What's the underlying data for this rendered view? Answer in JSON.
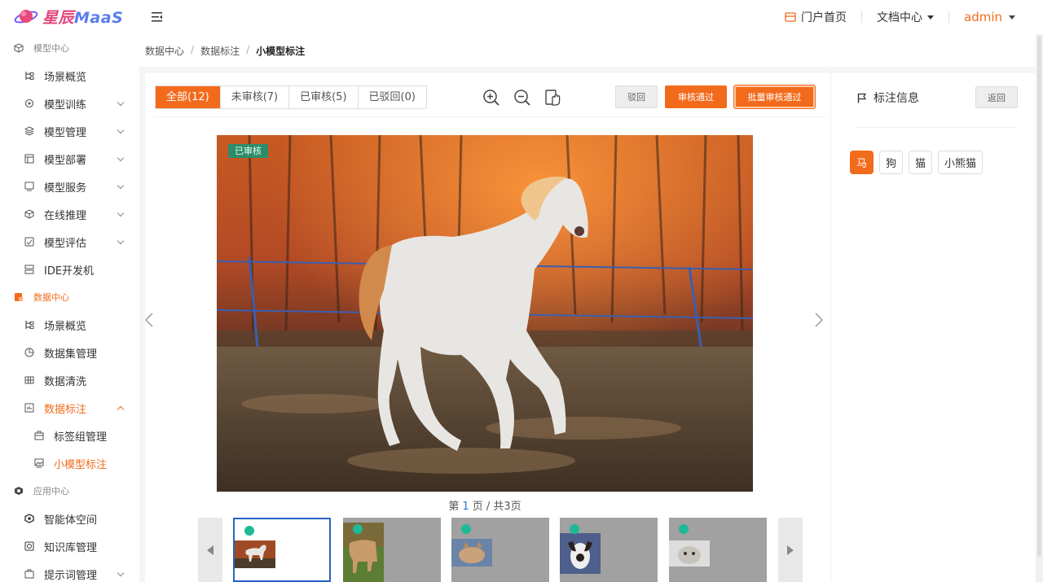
{
  "header": {
    "brand_cn": "星辰",
    "brand_en": "MaaS",
    "portal_link": "门户首页",
    "docs_link": "文档中心",
    "user": "admin"
  },
  "sidebar": {
    "groups": [
      {
        "label": "模型中心"
      },
      {
        "label": "数据中心"
      },
      {
        "label": "应用中心"
      }
    ],
    "model_items": [
      "场景概览",
      "模型训练",
      "模型管理",
      "模型部署",
      "模型服务",
      "在线推理",
      "模型评估",
      "IDE开发机"
    ],
    "data_items": [
      "场景概览",
      "数据集管理",
      "数据清洗",
      "数据标注"
    ],
    "annotation_sub": [
      "标签组管理",
      "小模型标注"
    ],
    "app_items": [
      "智能体空间",
      "知识库管理",
      "提示词管理"
    ]
  },
  "breadcrumb": [
    "数据中心",
    "数据标注",
    "小模型标注"
  ],
  "tabs": [
    "全部(12)",
    "未审核(7)",
    "已审核(5)",
    "已驳回(0)"
  ],
  "actions": {
    "reject": "驳回",
    "approve": "审核通过",
    "batch_approve": "批量审核通过"
  },
  "image": {
    "status_badge": "已审核"
  },
  "pager": {
    "prefix": "第",
    "page": "1",
    "suffix": "页 / 共3页"
  },
  "right_panel": {
    "title": "标注信息",
    "back": "返回",
    "tags": [
      "马",
      "狗",
      "猫",
      "小熊猫"
    ],
    "selected_tag": "马"
  },
  "colors": {
    "accent": "#f26b1d",
    "approved_badge": "#2d8d6b",
    "status_dot": "#1fb996",
    "selected_border": "#2563c7"
  }
}
